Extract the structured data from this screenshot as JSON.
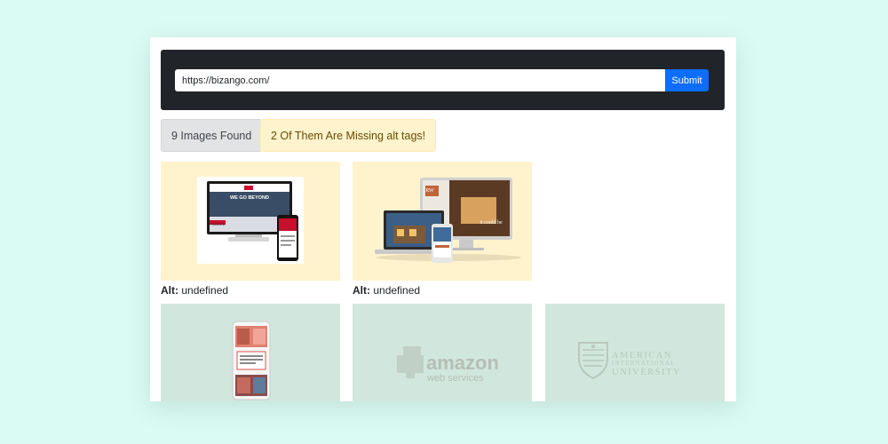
{
  "search": {
    "url_value": "https://bizango.com/",
    "submit_label": "Submit"
  },
  "badges": {
    "found": "9 Images Found",
    "missing": "2 Of Them Are Missing alt tags!"
  },
  "images": [
    {
      "status": "missing",
      "alt_label": "Alt:",
      "alt_value": "undefined",
      "screen_headline": "WE GO BEYOND",
      "screen_brand": "POLENTE",
      "thumb_icon": "desktop-phone-mockup-icon"
    },
    {
      "status": "missing",
      "alt_label": "Alt:",
      "alt_value": "undefined",
      "screen_badge": "RW",
      "screen_tagline": "it could be",
      "thumb_icon": "multi-device-mockup-icon"
    },
    {
      "status": "ok",
      "thumb_icon": "phone-mockup-icon"
    },
    {
      "status": "ok",
      "logo_line1": "amazon",
      "logo_line2": "web services",
      "thumb_icon": "amazon-web-services-logo"
    },
    {
      "status": "ok",
      "logo_line1": "AMERICAN",
      "logo_line2": "INTERNATIONAL",
      "logo_line3": "UNIVERSITY",
      "thumb_icon": "american-international-university-logo"
    }
  ],
  "colors": {
    "page_bg": "#d9fbf3",
    "topbar_bg": "#212529",
    "submit_bg": "#0d6efd",
    "missing_tile_bg": "#fff3cd",
    "ok_tile_bg": "#d1e7dd"
  }
}
